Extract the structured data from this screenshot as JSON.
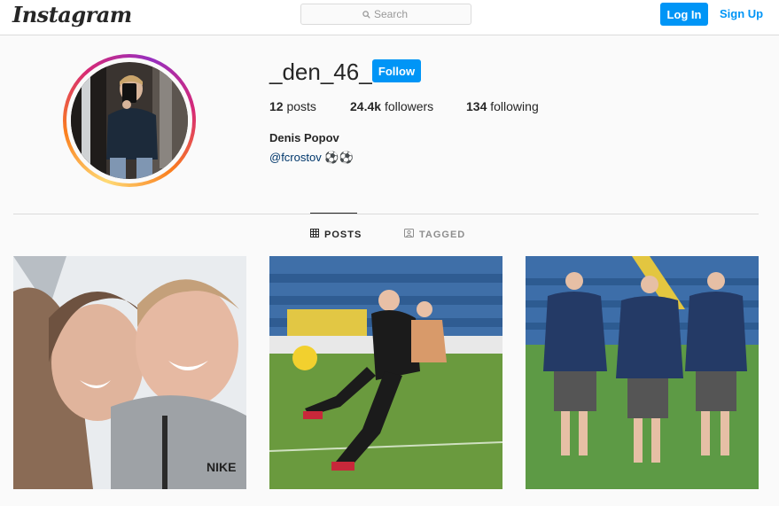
{
  "header": {
    "logo_text": "Instagram",
    "search_placeholder": "Search",
    "login_label": "Log In",
    "signup_label": "Sign Up"
  },
  "profile": {
    "username": "_den_46_",
    "follow_label": "Follow",
    "posts_count": "12",
    "posts_label": "posts",
    "followers_count": "24.4k",
    "followers_label": "followers",
    "following_count": "134",
    "following_label": "following",
    "full_name": "Denis Popov",
    "bio_link": "@fcrostov ⚽⚽"
  },
  "tabs": [
    {
      "label": "POSTS",
      "active": true,
      "icon": "grid-icon"
    },
    {
      "label": "TAGGED",
      "active": false,
      "icon": "tagged-icon"
    }
  ],
  "posts": [
    {
      "description_icon": "photo-couple-selfie"
    },
    {
      "description_icon": "photo-goalkeeper-kick"
    },
    {
      "description_icon": "photo-three-players-walking"
    }
  ],
  "colors": {
    "accent": "#0095f6",
    "link": "#00376b",
    "border": "#dbdbdb"
  }
}
